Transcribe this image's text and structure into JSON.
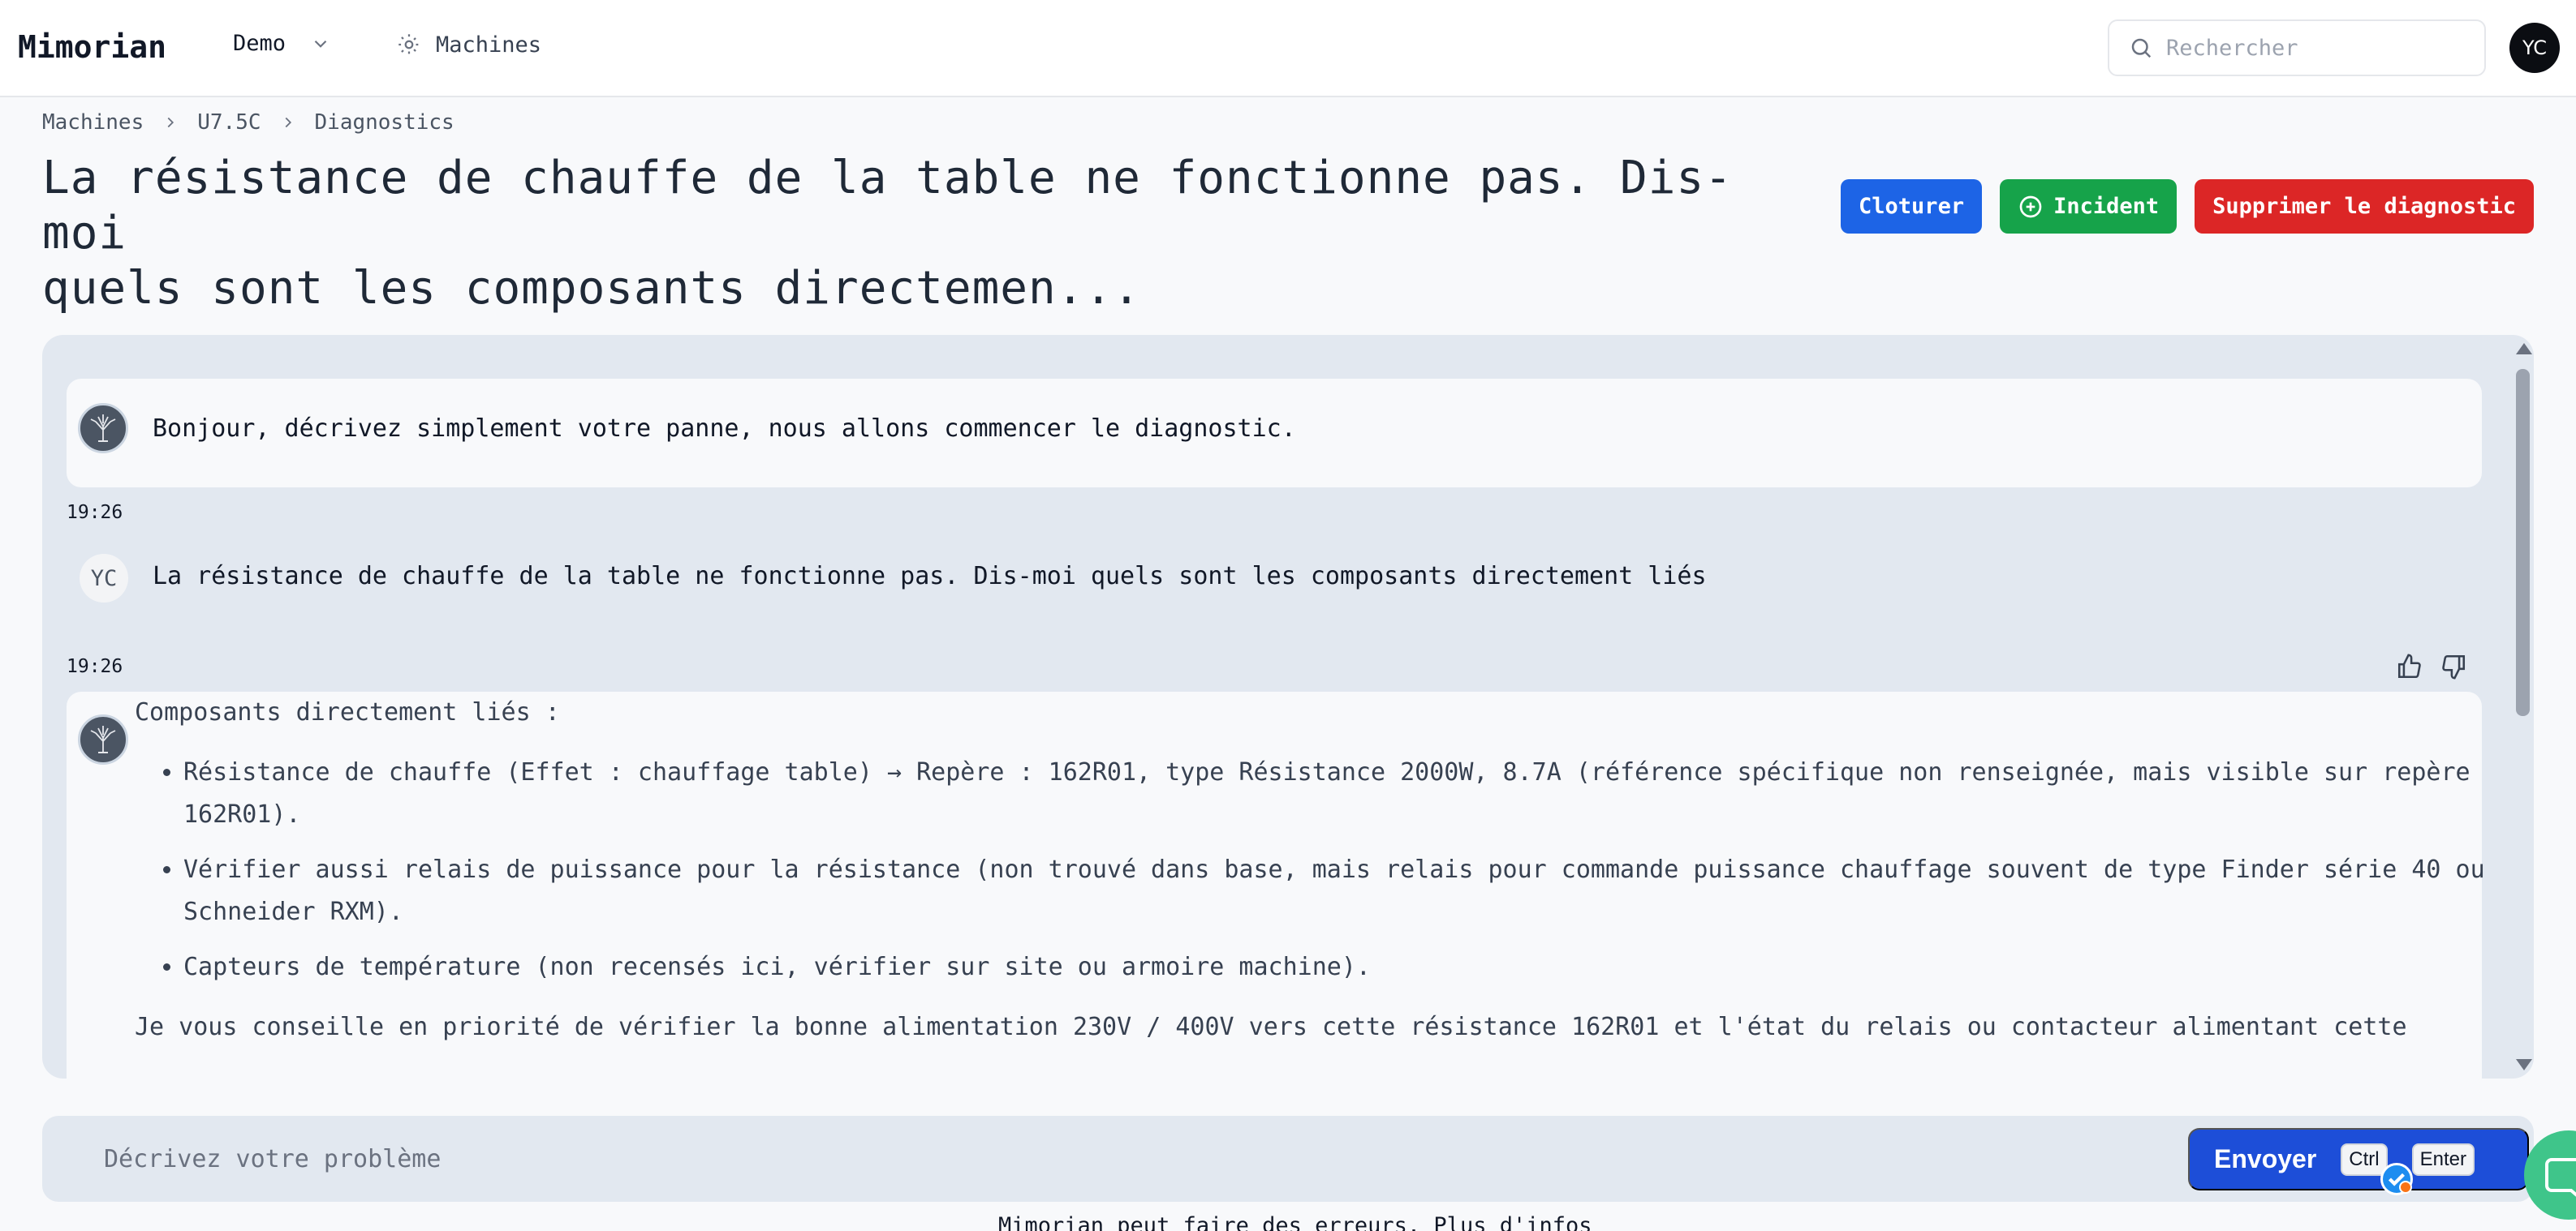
{
  "app": {
    "logo": "Mimorian",
    "workspace": "Demo",
    "nav_machines": "Machines",
    "search_placeholder": "Rechercher",
    "user_initials": "YC"
  },
  "breadcrumb": [
    "Machines",
    "U7.5C",
    "Diagnostics"
  ],
  "page": {
    "title_line1": "La résistance de chauffe de la table ne fonctionne pas. Dis-moi",
    "title_line2": "quels sont les composants directemen..."
  },
  "actions": {
    "close_label": "Cloturer",
    "incident_label": "Incident",
    "delete_label": "Supprimer le diagnostic",
    "colors": {
      "blue": "#1d64e6",
      "green": "#16a34a",
      "red": "#dc2626"
    }
  },
  "chat": {
    "bot_greeting": "Bonjour, décrivez simplement votre panne, nous allons commencer le diagnostic.",
    "time_1": "19:26",
    "user_message": "La résistance de chauffe de la table ne fonctionne pas. Dis-moi quels sont les composants directement liés",
    "time_2": "19:26",
    "reply": {
      "heading": "Composants directement liés :",
      "items": [
        "Résistance de chauffe (Effet : chauffage table) → Repère : 162R01, type Résistance 2000W, 8.7A (référence spécifique non renseignée, mais visible sur repère 162R01).",
        "Vérifier aussi relais de puissance pour la résistance (non trouvé dans base, mais relais pour commande puissance chauffage souvent de type Finder série 40 ou Schneider RXM).",
        "Capteurs de température (non recensés ici, vérifier sur site ou armoire machine)."
      ],
      "para": "Je vous conseille en priorité de vérifier la bonne alimentation 230V / 400V vers cette résistance 162R01 et l'état du relais ou contacteur alimentant cette"
    }
  },
  "composer": {
    "placeholder": "Décrivez votre problème",
    "send_label": "Envoyer",
    "kbd_ctrl": "Ctrl",
    "kbd_enter": "Enter"
  },
  "footer_note": "Mimorian peut faire des erreurs. Plus d'infos"
}
